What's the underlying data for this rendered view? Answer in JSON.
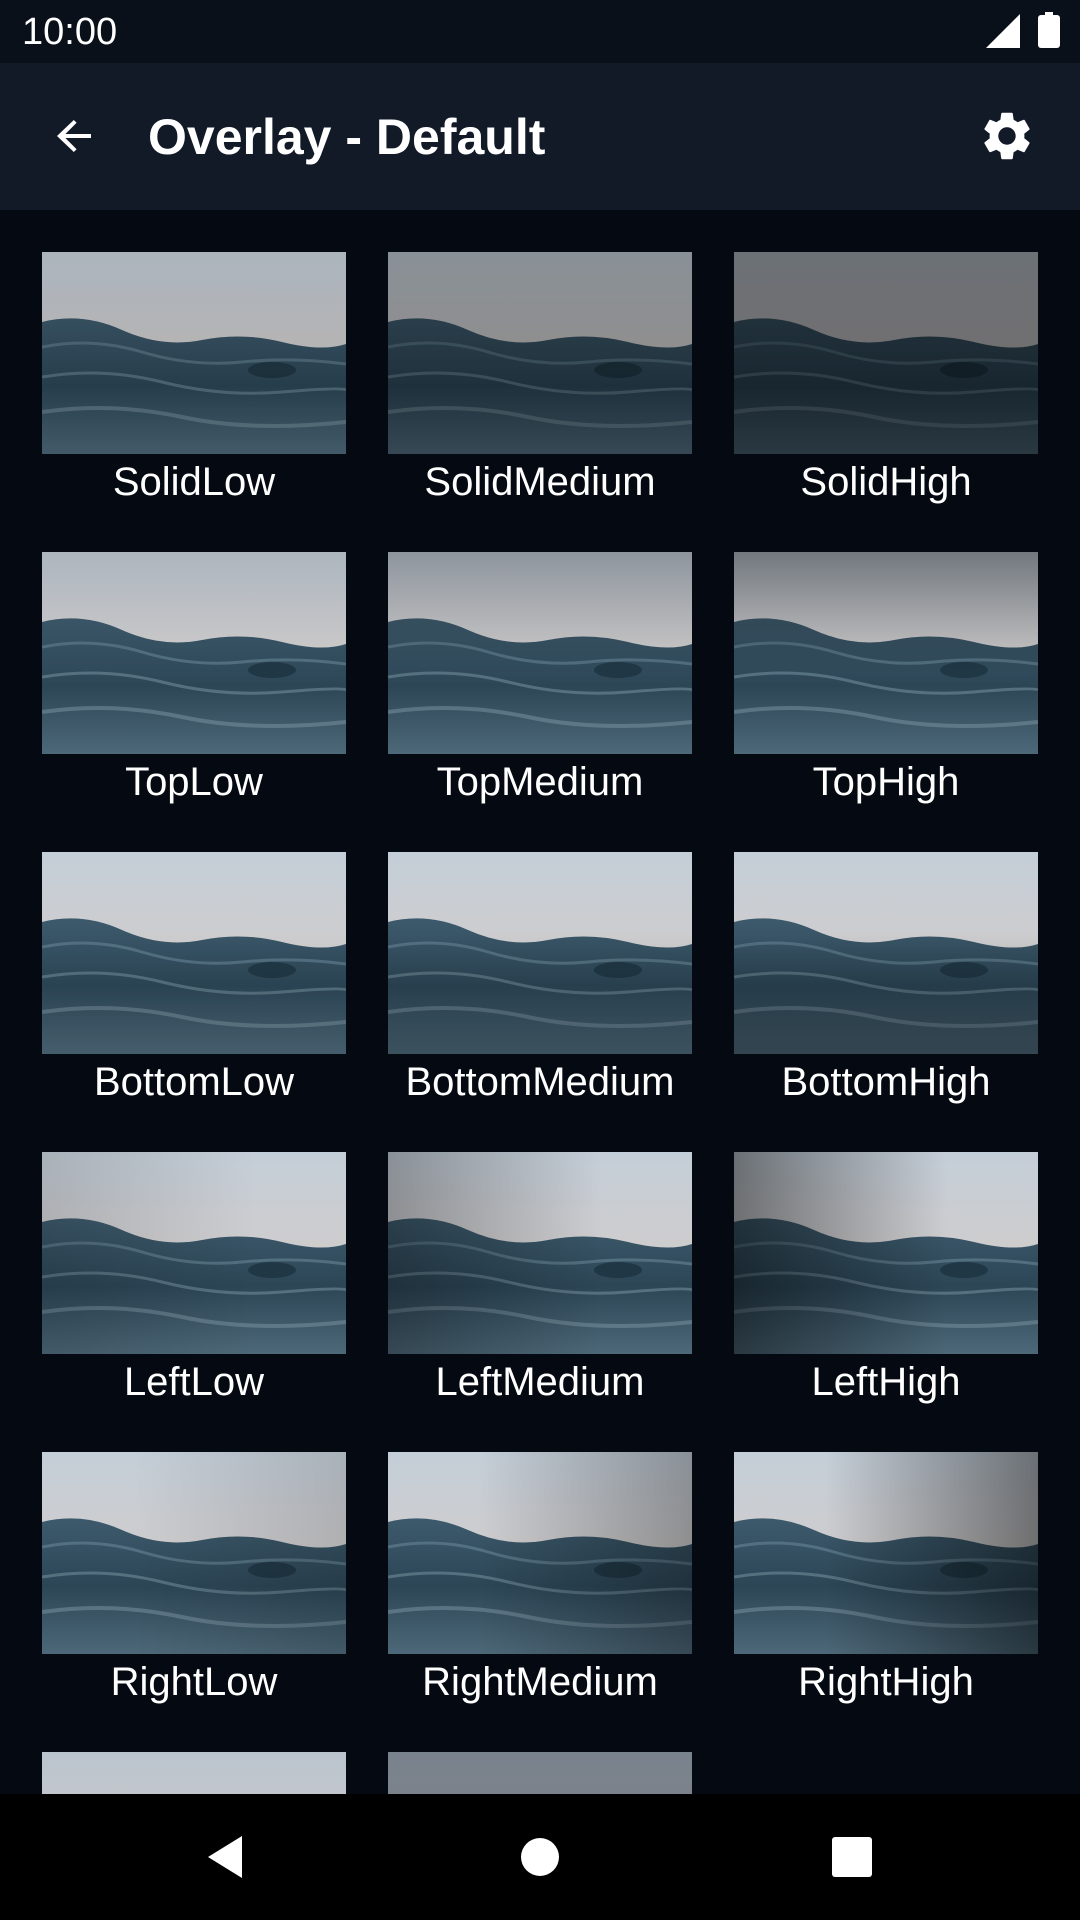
{
  "status_bar": {
    "time": "10:00",
    "signal_icon": "signal-icon",
    "battery_icon": "battery-icon"
  },
  "app_bar": {
    "title": "Overlay - Default",
    "back_icon": "arrow-back-icon",
    "settings_icon": "gear-icon"
  },
  "grid": {
    "items": [
      {
        "label": "SolidLow"
      },
      {
        "label": "SolidMedium"
      },
      {
        "label": "SolidHigh"
      },
      {
        "label": "TopLow"
      },
      {
        "label": "TopMedium"
      },
      {
        "label": "TopHigh"
      },
      {
        "label": "BottomLow"
      },
      {
        "label": "BottomMedium"
      },
      {
        "label": "BottomHigh"
      },
      {
        "label": "LeftLow"
      },
      {
        "label": "LeftMedium"
      },
      {
        "label": "LeftHigh"
      },
      {
        "label": "RightLow"
      },
      {
        "label": "RightMedium"
      },
      {
        "label": "RightHigh"
      },
      {
        "label": ""
      },
      {
        "label": ""
      }
    ]
  },
  "nav_bar": {
    "back_icon": "triangle-back-icon",
    "home_icon": "circle-home-icon",
    "recents_icon": "square-recents-icon"
  },
  "colors": {
    "background": "#050a12",
    "app_bar": "#121a28",
    "status_bar": "#0a101a",
    "text": "#ffffff"
  }
}
